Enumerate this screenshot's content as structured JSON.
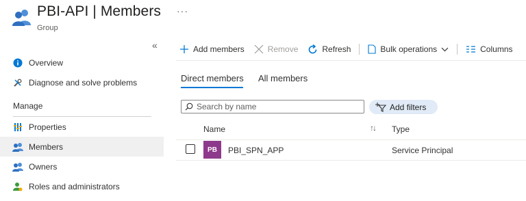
{
  "header": {
    "title": "PBI-API | Members",
    "subtitle": "Group",
    "more": "···"
  },
  "sidebar": {
    "collapse": "«",
    "items": [
      {
        "label": "Overview",
        "icon": "info-icon"
      },
      {
        "label": "Diagnose and solve problems",
        "icon": "wrench-icon"
      }
    ],
    "section": "Manage",
    "manage_items": [
      {
        "label": "Properties",
        "icon": "properties-icon"
      },
      {
        "label": "Members",
        "icon": "members-icon",
        "active": true
      },
      {
        "label": "Owners",
        "icon": "owners-icon"
      },
      {
        "label": "Roles and administrators",
        "icon": "roles-icon"
      }
    ]
  },
  "toolbar": {
    "add_members": "Add members",
    "remove": "Remove",
    "refresh": "Refresh",
    "bulk_operations": "Bulk operations",
    "columns": "Columns"
  },
  "tabs": [
    {
      "label": "Direct members",
      "selected": true
    },
    {
      "label": "All members",
      "selected": false
    }
  ],
  "search": {
    "placeholder": "Search by name",
    "value": ""
  },
  "filters": {
    "label": "Add filters"
  },
  "table": {
    "columns": [
      "Name",
      "Type"
    ],
    "rows": [
      {
        "initials": "PB",
        "name": "PBI_SPN_APP",
        "type": "Service Principal",
        "avatar_color": "#8e3a8c"
      }
    ]
  },
  "colors": {
    "accent": "#0078d4",
    "active_nav": "#f0f0f0",
    "filter_pill": "#e1ebf7"
  }
}
